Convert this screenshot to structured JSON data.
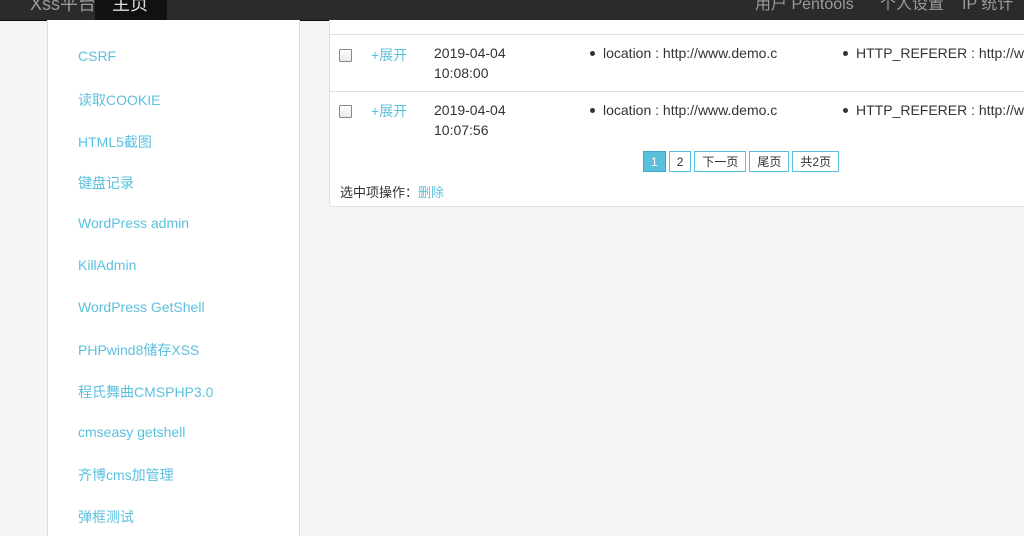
{
  "topbar": {
    "brand": "Xss平台",
    "active": "主页",
    "right_items": [
      "用户 Pentools",
      "个人设置",
      "IP 统计"
    ]
  },
  "sidebar": {
    "items": [
      {
        "label": "CSRF"
      },
      {
        "label": "读取COOKIE"
      },
      {
        "label": "HTML5截图"
      },
      {
        "label": "键盘记录"
      },
      {
        "label": "WordPress admin"
      },
      {
        "label": "KillAdmin"
      },
      {
        "label": "WordPress GetShell"
      },
      {
        "label": "PHPwind8储存XSS"
      },
      {
        "label": "程氏舞曲CMSPHP3.0"
      },
      {
        "label": "cmseasy getshell"
      },
      {
        "label": "齐博cms加管理"
      },
      {
        "label": "弹框测试"
      }
    ]
  },
  "table": {
    "rows": [
      {
        "expand": "+展开",
        "date": "2019-04-04",
        "time": "10:08:00",
        "location": "location : http://www.demo.c",
        "referer": "HTTP_REFERER : http://w"
      },
      {
        "expand": "+展开",
        "date": "2019-04-04",
        "time": "10:07:56",
        "location": "location : http://www.demo.c",
        "referer": "HTTP_REFERER : http://w"
      }
    ]
  },
  "pagination": {
    "items": [
      "1",
      "2",
      "下一页",
      "尾页",
      "共2页"
    ],
    "active": "1"
  },
  "ops": {
    "label": "选中项操作：",
    "delete": "删除"
  }
}
